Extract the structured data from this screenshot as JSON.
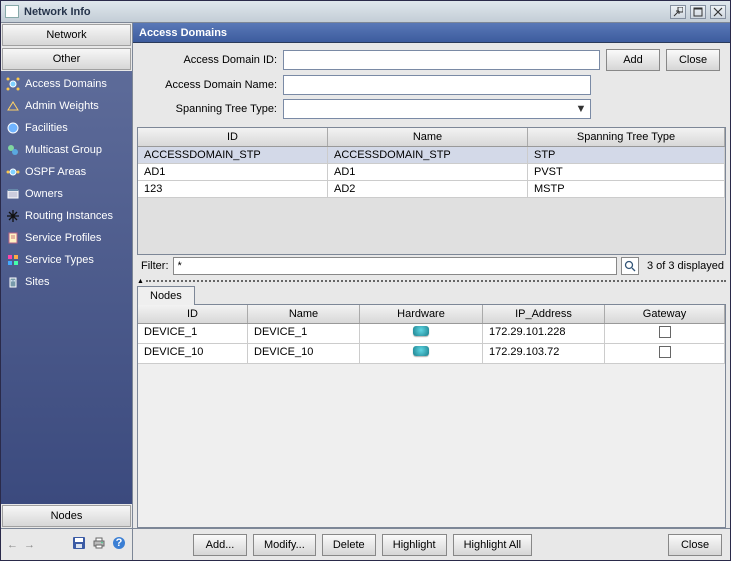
{
  "window": {
    "title": "Network Info"
  },
  "sidebar": {
    "top_button": "Network",
    "other_button": "Other",
    "bottom_button": "Nodes",
    "items": [
      {
        "label": "Access Domains"
      },
      {
        "label": "Admin Weights"
      },
      {
        "label": "Facilities"
      },
      {
        "label": "Multicast Group"
      },
      {
        "label": "OSPF Areas"
      },
      {
        "label": "Owners"
      },
      {
        "label": "Routing Instances"
      },
      {
        "label": "Service Profiles"
      },
      {
        "label": "Service Types"
      },
      {
        "label": "Sites"
      }
    ]
  },
  "main": {
    "header": "Access Domains",
    "form": {
      "id_label": "Access Domain ID:",
      "id_value": "",
      "name_label": "Access Domain Name:",
      "name_value": "",
      "stt_label": "Spanning Tree Type:",
      "stt_value": "",
      "add_btn": "Add",
      "close_btn": "Close"
    },
    "table1": {
      "headers": {
        "id": "ID",
        "name": "Name",
        "stt": "Spanning Tree Type"
      },
      "rows": [
        {
          "id": "ACCESSDOMAIN_STP",
          "name": "ACCESSDOMAIN_STP",
          "stt": "STP"
        },
        {
          "id": "AD1",
          "name": "AD1",
          "stt": "PVST"
        },
        {
          "id": "123",
          "name": "AD2",
          "stt": "MSTP"
        }
      ]
    },
    "filter": {
      "label": "Filter:",
      "value": "*",
      "count": "3 of 3 displayed"
    },
    "tabs": {
      "nodes": "Nodes"
    },
    "table2": {
      "headers": {
        "id": "ID",
        "name": "Name",
        "hw": "Hardware",
        "ip": "IP_Address",
        "gw": "Gateway"
      },
      "rows": [
        {
          "id": "DEVICE_1",
          "name": "DEVICE_1",
          "ip": "172.29.101.228"
        },
        {
          "id": "DEVICE_10",
          "name": "DEVICE_10",
          "ip": "172.29.103.72"
        }
      ]
    }
  },
  "bottom": {
    "add": "Add...",
    "modify": "Modify...",
    "delete": "Delete",
    "highlight": "Highlight",
    "highlight_all": "Highlight All",
    "close": "Close"
  }
}
